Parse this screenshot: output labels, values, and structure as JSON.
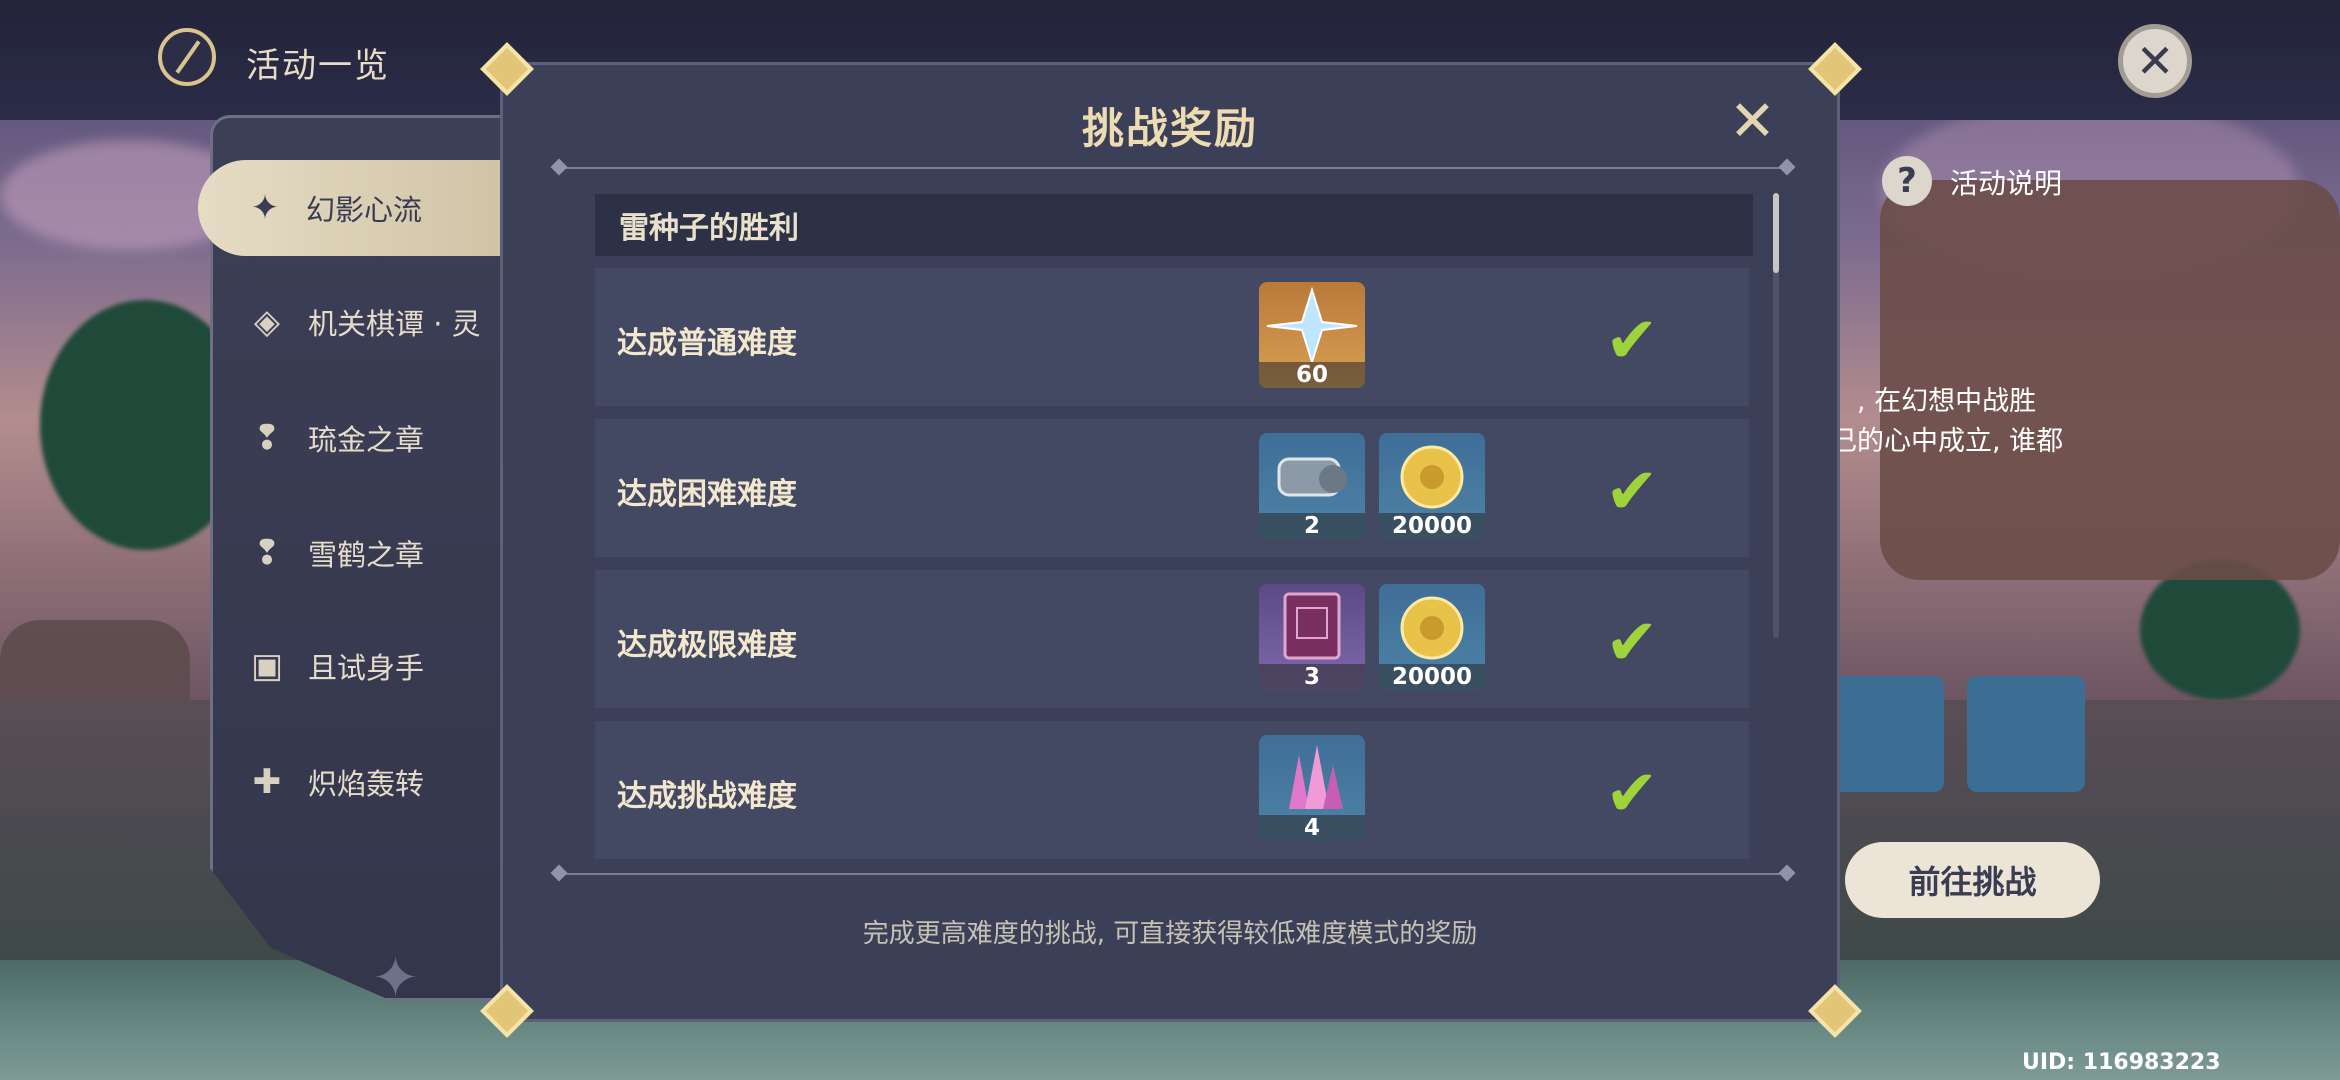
{
  "header": {
    "title": "活动一览"
  },
  "sidebar": {
    "items": [
      {
        "label": "幻影心流",
        "icon": "phantom-icon",
        "active": true
      },
      {
        "label": "机关棋谭 · 灵",
        "icon": "chess-icon",
        "active": false
      },
      {
        "label": "琉金之章",
        "icon": "exclamation-icon",
        "active": false
      },
      {
        "label": "雪鹤之章",
        "icon": "exclamation-icon",
        "active": false
      },
      {
        "label": "且试身手",
        "icon": "cards-icon",
        "active": false
      },
      {
        "label": "炽焰轰转",
        "icon": "flame-icon",
        "active": false
      }
    ]
  },
  "background": {
    "help_label": "活动说明",
    "description_lines": [
      "」, 在幻想中战胜",
      "己的心中成立, 谁都"
    ],
    "go_button": "前往挑战",
    "uid": "UID: 116983223"
  },
  "modal": {
    "title": "挑战奖励",
    "section": "雷种子的胜利",
    "rows": [
      {
        "label": "达成普通难度",
        "rewards": [
          {
            "name": "primogem",
            "count": "60",
            "color": "orange"
          }
        ],
        "completed": true
      },
      {
        "label": "达成困难难度",
        "rewards": [
          {
            "name": "mystic-enhancement-ore",
            "count": "2",
            "color": "blue"
          },
          {
            "name": "mora",
            "count": "20000",
            "color": "blue"
          }
        ],
        "completed": true
      },
      {
        "label": "达成极限难度",
        "rewards": [
          {
            "name": "heros-wit",
            "count": "3",
            "color": "purple"
          },
          {
            "name": "mora",
            "count": "20000",
            "color": "blue"
          }
        ],
        "completed": true
      },
      {
        "label": "达成挑战难度",
        "rewards": [
          {
            "name": "crystal-chunk",
            "count": "4",
            "color": "blue"
          }
        ],
        "completed": true
      }
    ],
    "footnote": "完成更高难度的挑战, 可直接获得较低难度模式的奖励"
  }
}
